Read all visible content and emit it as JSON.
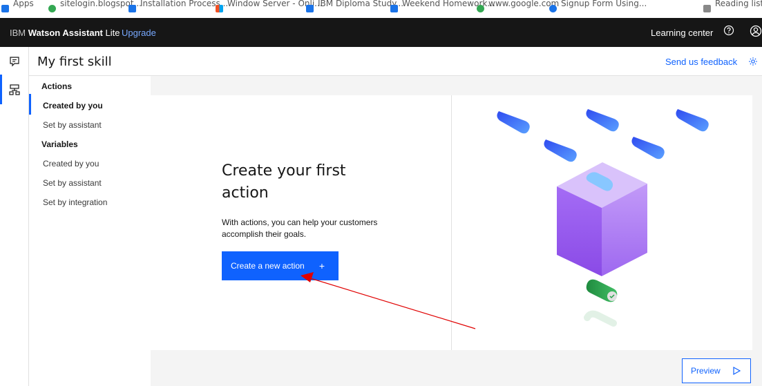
{
  "browser": {
    "bookmarks": [
      {
        "label": "Apps"
      },
      {
        "label": "sitelogin.blogspot..."
      },
      {
        "label": "Installation Process..."
      },
      {
        "label": "Window Server - Onli..."
      },
      {
        "label": "IBM Diploma Study..."
      },
      {
        "label": "Weekend Homework..."
      },
      {
        "label": "www.google.com"
      },
      {
        "label": "Signup Form Using..."
      },
      {
        "label": "Reading list"
      }
    ]
  },
  "topbar": {
    "brand_ibm": "IBM",
    "brand_name": "Watson Assistant",
    "brand_plan": "Lite",
    "upgrade": "Upgrade",
    "learning_center": "Learning center"
  },
  "header": {
    "title": "My first skill",
    "feedback": "Send us feedback"
  },
  "nav": {
    "actions_heading": "Actions",
    "actions_items": [
      "Created by you",
      "Set by assistant"
    ],
    "variables_heading": "Variables",
    "variables_items": [
      "Created by you",
      "Set by assistant",
      "Set by integration"
    ]
  },
  "empty_state": {
    "title": "Create your first action",
    "description": "With actions, you can help your customers accomplish their goals.",
    "cta_label": "Create a new action",
    "cta_icon": "+"
  },
  "footer": {
    "preview_label": "Preview"
  },
  "colors": {
    "accent": "#0f62fe",
    "topbar": "#161616",
    "annotation": "#e00000"
  }
}
